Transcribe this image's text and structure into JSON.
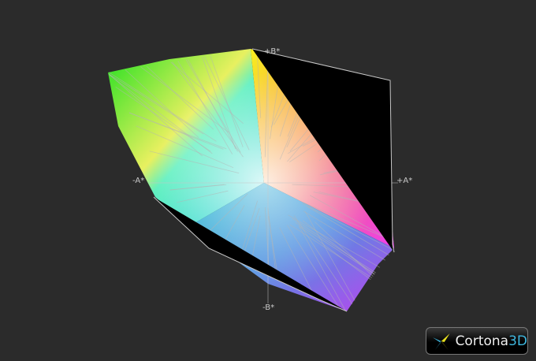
{
  "axes": {
    "plus_b": "+B*",
    "minus_b": "-B*",
    "plus_a": "+A*",
    "minus_a": "-A*"
  },
  "logo": {
    "name": "Cortona",
    "suffix": "3D"
  },
  "colors": {
    "background": "#2b2b2b",
    "wireframe": "#b4b4b4"
  }
}
